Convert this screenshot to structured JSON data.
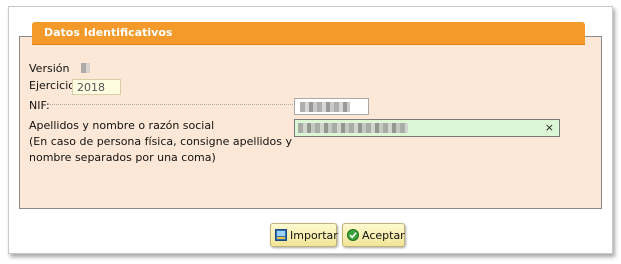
{
  "section": {
    "title": "Datos Identificativos"
  },
  "form": {
    "version_label": "Versión",
    "ejercicio_label": "Ejercicio",
    "ejercicio_value": "2018",
    "nif_label": "NIF:",
    "name_label_line1": "Apellidos y nombre o razón social",
    "name_label_line2": "(En caso de persona física, consigne apellidos y",
    "name_label_line3": "nombre separados por una coma)",
    "clear_symbol": "×"
  },
  "buttons": {
    "import_label": "Importar",
    "accept_label": "Aceptar"
  },
  "icons": {
    "import": "import-icon",
    "accept": "check-icon"
  },
  "colors": {
    "header": "#f49a2a",
    "panel": "#fde8d7",
    "input_highlight": "#dcf7d6"
  }
}
